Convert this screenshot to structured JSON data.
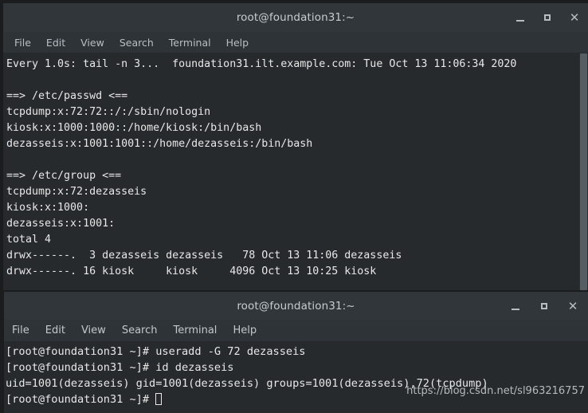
{
  "desktop": {
    "background_color": "#1a1c1e"
  },
  "windows": [
    {
      "id": "top",
      "title": "root@foundation31:~",
      "menu": [
        "File",
        "Edit",
        "View",
        "Search",
        "Terminal",
        "Help"
      ],
      "controls": {
        "minimize": "minimize",
        "maximize": "maximize",
        "close": "close"
      },
      "terminal": {
        "background_color": "#262a2c",
        "foreground_color": "#e8e8e8",
        "lines": [
          "Every 1.0s: tail -n 3...  foundation31.ilt.example.com: Tue Oct 13 11:06:34 2020",
          "",
          "==> /etc/passwd <==",
          "tcpdump:x:72:72::/:/sbin/nologin",
          "kiosk:x:1000:1000::/home/kiosk:/bin/bash",
          "dezasseis:x:1001:1001::/home/dezasseis:/bin/bash",
          "",
          "==> /etc/group <==",
          "tcpdump:x:72:dezasseis",
          "kiosk:x:1000:",
          "dezasseis:x:1001:",
          "total 4",
          "drwx------.  3 dezasseis dezasseis   78 Oct 13 11:06 dezasseis",
          "drwx------. 16 kiosk     kiosk     4096 Oct 13 10:25 kiosk"
        ]
      },
      "scrollbar": {
        "present": true
      }
    },
    {
      "id": "bottom",
      "title": "root@foundation31:~",
      "menu": [
        "File",
        "Edit",
        "View",
        "Search",
        "Terminal",
        "Help"
      ],
      "controls": {
        "minimize": "minimize",
        "maximize": "maximize",
        "close": "close"
      },
      "terminal": {
        "background_color": "#262a2c",
        "foreground_color": "#e8e8e8",
        "lines": [
          "[root@foundation31 ~]# useradd -G 72 dezasseis",
          "[root@foundation31 ~]# id dezasseis",
          "uid=1001(dezasseis) gid=1001(dezasseis) groups=1001(dezasseis),72(tcpdump)"
        ],
        "prompt": "[root@foundation31 ~]# ",
        "cursor": "block"
      },
      "scrollbar": {
        "present": false
      }
    }
  ],
  "watermark": {
    "text": "https://blog.csdn.net/sl963216757"
  }
}
